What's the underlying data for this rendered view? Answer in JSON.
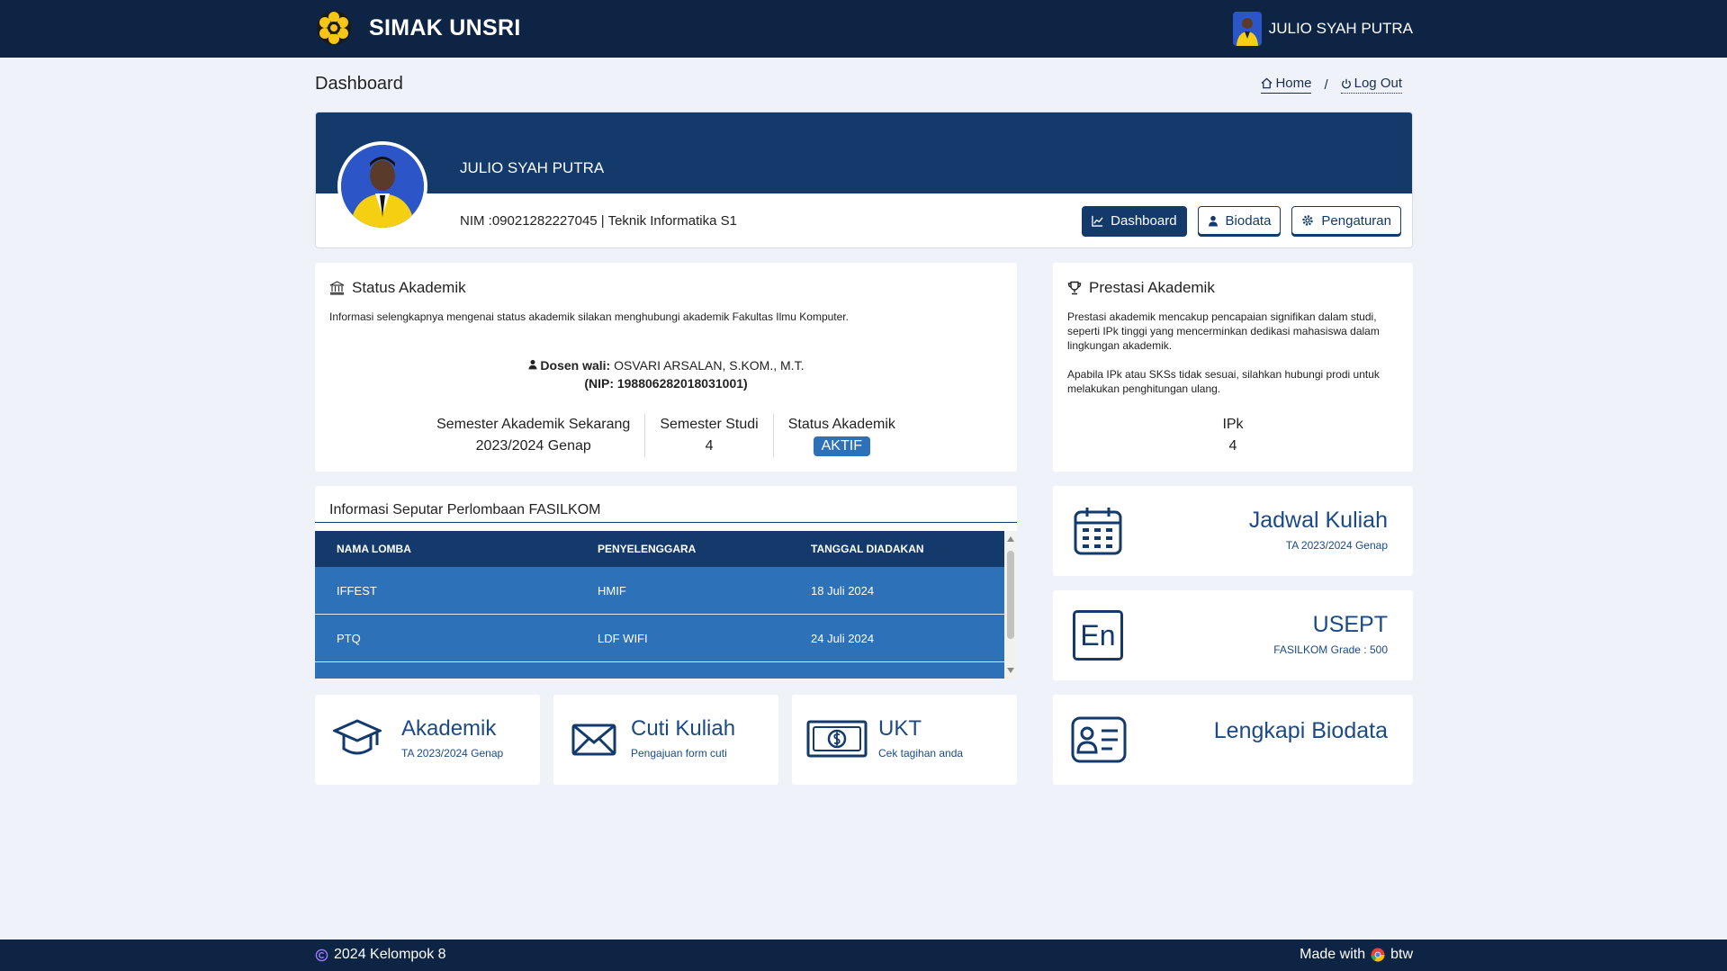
{
  "navbar": {
    "brand": "SIMAK UNSRI",
    "user_name": "JULIO SYAH PUTRA"
  },
  "page": {
    "title": "Dashboard"
  },
  "breadcrumb": {
    "home": "Home",
    "separator": "/",
    "logout": "Log Out"
  },
  "profile": {
    "name": "JULIO SYAH PUTRA",
    "meta": "NIM :09021282227045 | Teknik Informatika S1",
    "buttons": {
      "dashboard": "Dashboard",
      "biodata": "Biodata",
      "pengaturan": "Pengaturan"
    }
  },
  "status": {
    "title": "Status Akademik",
    "info": "Informasi selengkapnya mengenai status akademik silakan menghubungi akademik Fakultas Ilmu Komputer.",
    "dosen_label": "Dosen wali:",
    "dosen_name": " OSVARI ARSALAN, S.KOM., M.T.",
    "nip": "(NIP: 198806282018031001)",
    "semester_label": "Semester Akademik Sekarang",
    "semester_value": "2023/2024 Genap",
    "studi_label": "Semester Studi",
    "studi_value": "4",
    "status_label": "Status Akademik",
    "status_value": "AKTIF"
  },
  "prestasi": {
    "title": "Prestasi Akademik",
    "desc1": "Prestasi akademik mencakup pencapaian signifikan dalam studi, seperti IPk tinggi yang mencerminkan dedikasi mahasiswa dalam lingkungan akademik.",
    "desc2": "Apabila IPk atau SKSs tidak sesuai, silahkan hubungi prodi untuk melakukan penghitungan ulang.",
    "ipk_label": "IPk",
    "ipk_value": "4"
  },
  "lomba": {
    "title": "Informasi Seputar Perlombaan FASILKOM",
    "headers": [
      "NAMA LOMBA",
      "PENYELENGGARA",
      "TANGGAL DIADAKAN"
    ],
    "rows": [
      [
        "IFFEST",
        "HMIF",
        "18 Juli 2024"
      ],
      [
        "PTQ",
        "LDF WIFI",
        "24 Juli 2024"
      ]
    ]
  },
  "tiles": {
    "jadwal": {
      "title": "Jadwal Kuliah",
      "sub": "TA 2023/2024 Genap"
    },
    "usept": {
      "title": "USEPT",
      "sub": "FASILKOM Grade : 500",
      "icon_text": "En"
    },
    "biodata": {
      "title": "Lengkapi Biodata"
    },
    "akademik": {
      "title": "Akademik",
      "sub": "TA 2023/2024 Genap"
    },
    "cuti": {
      "title": "Cuti Kuliah",
      "sub": "Pengajuan form cuti"
    },
    "ukt": {
      "title": "UKT",
      "sub": "Cek tagihan anda"
    }
  },
  "footer": {
    "left": "2024 Kelompok 8",
    "right_prefix": "Made with",
    "right_suffix": "btw"
  },
  "colors": {
    "navy": "#0e2445",
    "primary": "#133a6b",
    "accent": "#2d72b8",
    "tile_text": "#1b4a85"
  }
}
